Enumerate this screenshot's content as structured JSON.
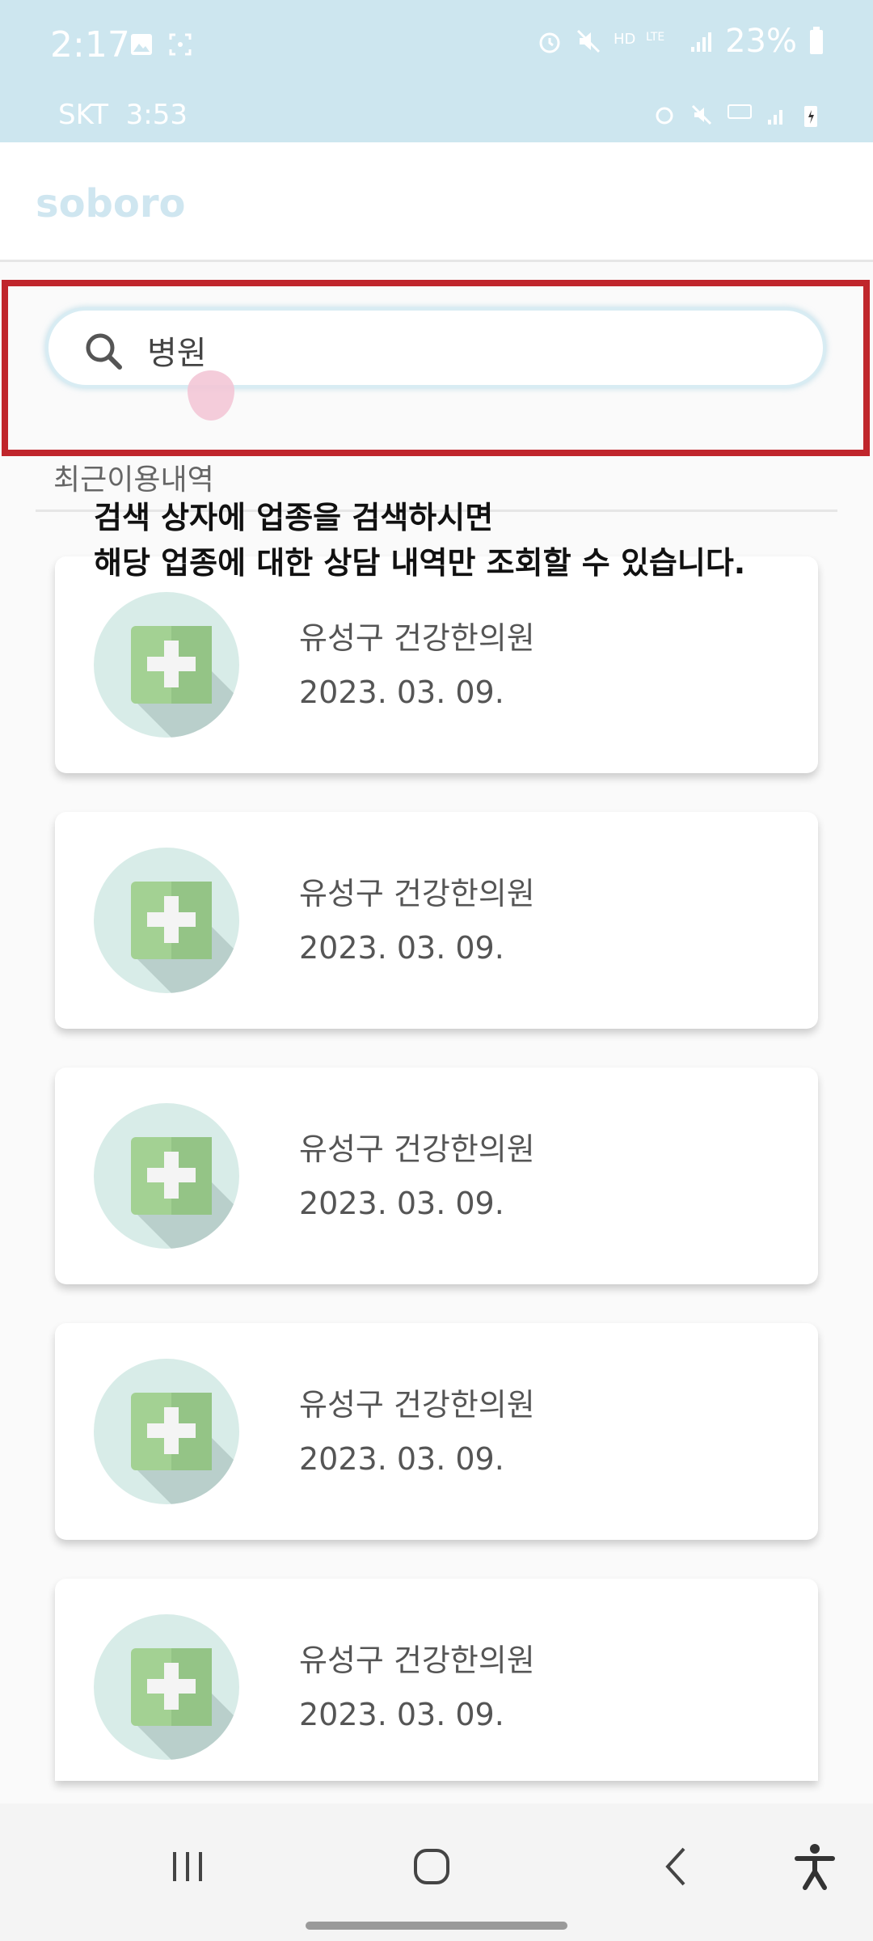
{
  "status_bar": {
    "time": "2:17",
    "battery": "23%",
    "inner_carrier": "SKT",
    "inner_time": "3:53"
  },
  "app": {
    "title": "soboro"
  },
  "search": {
    "value": "병원"
  },
  "recent": {
    "label": "최근이용내역"
  },
  "overlay": {
    "line1": "검색 상자에 업종을 검색하시면",
    "line2": "해당 업종에 대한 상담 내역만 조회할 수 있습니다."
  },
  "items": [
    {
      "name": "유성구 건강한의원",
      "date": "2023. 03. 09."
    },
    {
      "name": "유성구 건강한의원",
      "date": "2023. 03. 09."
    },
    {
      "name": "유성구 건강한의원",
      "date": "2023. 03. 09."
    },
    {
      "name": "유성구 건강한의원",
      "date": "2023. 03. 09."
    },
    {
      "name": "유성구 건강한의원",
      "date": "2023. 03. 09."
    }
  ],
  "icons": {
    "search": "search-icon",
    "hospital": "medical-cross-icon",
    "nav_recent": "recent-apps-icon",
    "nav_home": "home-icon",
    "nav_back": "back-icon",
    "nav_accessibility": "accessibility-icon"
  },
  "colors": {
    "status_bg": "#cde6ef",
    "highlight": "#c0262c",
    "cross_green": "#9ccc8e",
    "avatar_bg": "#d8ece8"
  }
}
